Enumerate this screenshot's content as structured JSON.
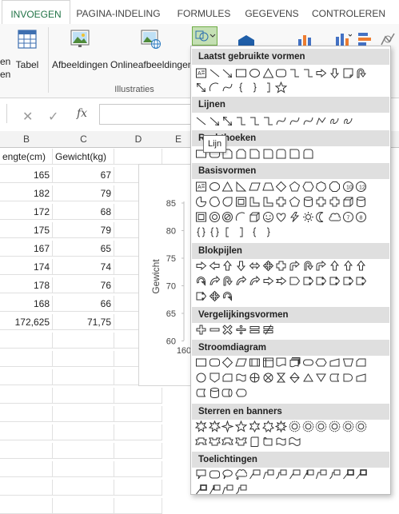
{
  "tabs": [
    {
      "label": "INVOEGEN",
      "active": true
    },
    {
      "label": "PAGINA-INDELING"
    },
    {
      "label": "FORMULES"
    },
    {
      "label": "GEGEVENS"
    },
    {
      "label": "CONTROLEREN"
    }
  ],
  "ribbon": {
    "partial_left_lines": [
      "en",
      "en"
    ],
    "tabel_label": "Tabel",
    "afbeeldingen_label": "Afbeeldingen",
    "online_label": "Onlineafbeeldingen",
    "group_illustraties": "Illustraties"
  },
  "formula_bar": {
    "cancel": "✕",
    "confirm": "✓",
    "fx": "fx",
    "value": ""
  },
  "sheet": {
    "columns": [
      "B",
      "C",
      "D",
      "E"
    ],
    "header_row": [
      "engte(cm)",
      "Gewicht(kg)"
    ],
    "rows": [
      [
        "165",
        "67"
      ],
      [
        "182",
        "79"
      ],
      [
        "172",
        "68"
      ],
      [
        "175",
        "79"
      ],
      [
        "167",
        "65"
      ],
      [
        "174",
        "74"
      ],
      [
        "178",
        "76"
      ],
      [
        "168",
        "66"
      ],
      [
        "172,625",
        "71,75"
      ]
    ]
  },
  "chart": {
    "ylabel": "Gewicht",
    "yticks": [
      "85",
      "80",
      "75",
      "70",
      "65",
      "60"
    ],
    "xtick_first": "160"
  },
  "shapes_menu": {
    "sections": [
      "Laatst gebruikte vormen",
      "Lijnen",
      "Rechthoeken",
      "Basisvormen",
      "Blokpijlen",
      "Vergelijkingsvormen",
      "Stroomdiagram",
      "Sterren en banners",
      "Toelichtingen"
    ],
    "tooltip": "Lijn"
  },
  "colors": {
    "accent": "#217346",
    "menu_header": "#dfdfdf",
    "icon_stroke": "#333333"
  }
}
